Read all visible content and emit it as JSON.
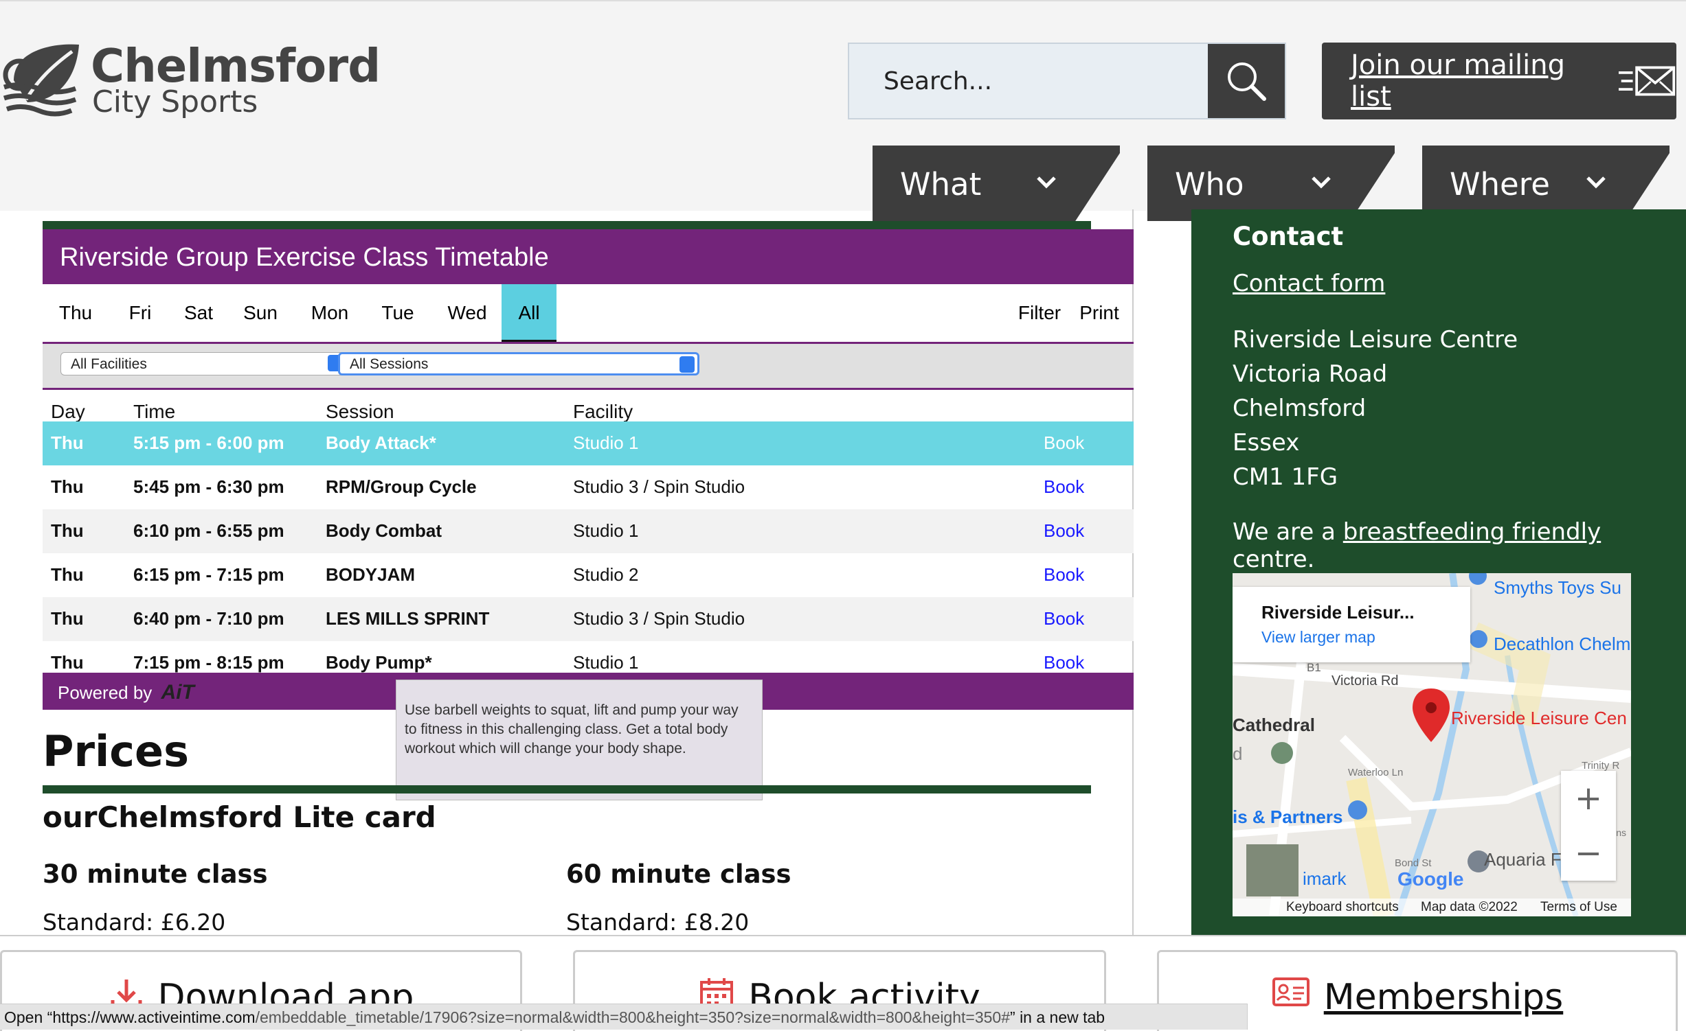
{
  "header": {
    "logo_line1": "Chelmsford",
    "logo_line2": "City Sports",
    "search_placeholder": "Search...",
    "mailing_list_label": "Join our mailing list",
    "nav": [
      {
        "label": "What"
      },
      {
        "label": "Who"
      },
      {
        "label": "Where"
      }
    ]
  },
  "timetable": {
    "title": "Riverside Group Exercise Class Timetable",
    "days": [
      "Thu",
      "Fri",
      "Sat",
      "Sun",
      "Mon",
      "Tue",
      "Wed",
      "All"
    ],
    "active_day": "All",
    "filter_label": "Filter",
    "print_label": "Print",
    "facility_select": "All Facilities",
    "session_select": "All Sessions",
    "columns": [
      "Day",
      "Time",
      "Session",
      "Facility"
    ],
    "rows": [
      {
        "day": "Thu",
        "time": "5:15 pm - 6:00 pm",
        "session": "Body Attack*",
        "facility": "Studio 1",
        "book": "Book"
      },
      {
        "day": "Thu",
        "time": "5:45 pm - 6:30 pm",
        "session": "RPM/Group Cycle",
        "facility": "Studio 3 / Spin Studio",
        "book": "Book"
      },
      {
        "day": "Thu",
        "time": "6:10 pm - 6:55 pm",
        "session": "Body Combat",
        "facility": "Studio 1",
        "book": "Book"
      },
      {
        "day": "Thu",
        "time": "6:15 pm - 7:15 pm",
        "session": "BODYJAM",
        "facility": "Studio 2",
        "book": "Book"
      },
      {
        "day": "Thu",
        "time": "6:40 pm - 7:10 pm",
        "session": "LES MILLS SPRINT",
        "facility": "Studio 3 / Spin Studio",
        "book": "Book"
      },
      {
        "day": "Thu",
        "time": "7:15 pm - 8:15 pm",
        "session": "Body Pump*",
        "facility": "Studio 1",
        "book": "Book"
      }
    ],
    "powered_by": "Powered by",
    "powered_by_brand": "AiT",
    "tooltip": "Use barbell weights to squat, lift and pump your way to fitness in this challenging class. Get a total body workout which will change your body shape."
  },
  "prices": {
    "heading": "Prices",
    "card_heading": "ourChelmsford Lite card",
    "class30": "30 minute class",
    "class60": "60 minute class",
    "standard30": "Standard: £6.20",
    "standard60": "Standard: £8.20"
  },
  "sidebar": {
    "heading": "Contact",
    "contact_link": "Contact form",
    "address": [
      "Riverside Leisure Centre",
      "Victoria Road",
      "Chelmsford",
      "Essex",
      "CM1 1FG"
    ],
    "bf_prefix": "We are a ",
    "bf_link": "breastfeeding friendly",
    "bf_suffix": " centre.",
    "map": {
      "card_title": "Riverside Leisur...",
      "card_link": "View larger map",
      "labels": {
        "smyths": "Smyths Toys Su",
        "decathlon": "Decathlon Chelm",
        "victoria": "Victoria Rd",
        "cathedral": "Cathedral",
        "riverside": "Riverside Leisure Cen",
        "partners": "is & Partners",
        "aquaria": "Aquaria F",
        "imark": "imark",
        "b1": "B1",
        "d": "d",
        "waterloo": "Waterloo Ln",
        "bond": "Bond St",
        "trinity": "Trinity R",
        "queens": "Queens",
        "google": "Google"
      },
      "footer": {
        "shortcuts": "Keyboard shortcuts",
        "mapdata": "Map data ©2022",
        "terms": "Terms of Use"
      }
    }
  },
  "bottombar": {
    "download": "Download app",
    "book": "Book activity",
    "memberships": "Memberships"
  },
  "statusbar": {
    "prefix": "Open “",
    "url_host": "https://www.activeintime.com",
    "url_path": "/embeddable_timetable/17906?size=normal&width=800&height=350?size=normal&width=800&height=350#",
    "suffix": "” in a new tab"
  },
  "colors": {
    "purple": "#73247a",
    "green": "#1e4d2b",
    "cyan": "#5ccfe0",
    "dark": "#3d3d3d"
  }
}
